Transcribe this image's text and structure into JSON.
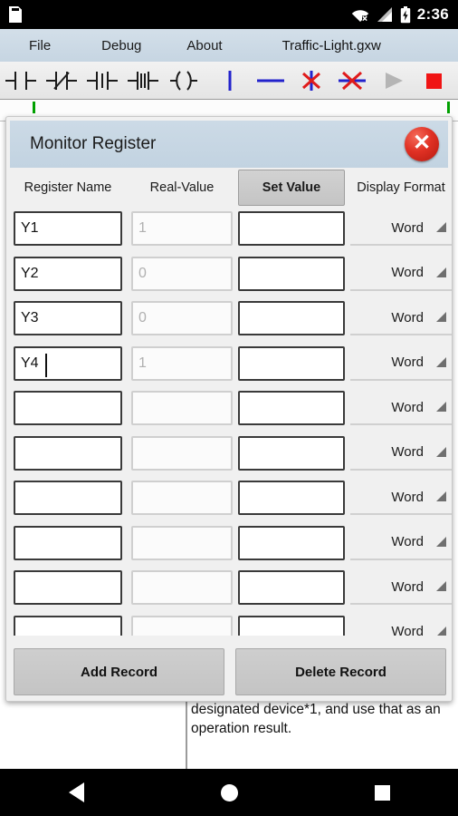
{
  "status_bar": {
    "storage_icon": "sdcard-icon",
    "wifi_icon": "wifi-off-icon",
    "signal_icon": "signal-bars-icon",
    "battery_icon": "battery-charging-icon",
    "time": "2:36"
  },
  "menubar": {
    "items": [
      {
        "label": "File",
        "name": "menu-file"
      },
      {
        "label": "Debug",
        "name": "menu-debug"
      },
      {
        "label": "About",
        "name": "menu-about"
      }
    ],
    "filename": "Traffic-Light.gxw"
  },
  "toolbar": {
    "icons": [
      "contact-no-icon",
      "contact-nc-icon",
      "contact-rising-icon",
      "contact-falling-icon",
      "coil-icon",
      "vertical-line-icon",
      "horizontal-line-icon",
      "delete-vertical-icon",
      "delete-horizontal-icon",
      "run-icon",
      "stop-icon"
    ],
    "accent_blue": "#2222cc",
    "accent_red": "#e01b1b",
    "run_disabled": "#b5b5b5"
  },
  "dialog": {
    "title": "Monitor Register",
    "close_label": "✕",
    "columns": [
      {
        "label": "Register Name",
        "name": "column-register-name"
      },
      {
        "label": "Real-Value",
        "name": "column-real-value"
      },
      {
        "label": "Set Value",
        "name": "column-set-value"
      },
      {
        "label": "Display Format",
        "name": "column-display-format"
      }
    ],
    "rows": [
      {
        "register_name": "Y1",
        "real_value": "1",
        "set_value": "",
        "display_format": "Word",
        "caret": false
      },
      {
        "register_name": "Y2",
        "real_value": "0",
        "set_value": "",
        "display_format": "Word",
        "caret": false
      },
      {
        "register_name": "Y3",
        "real_value": "0",
        "set_value": "",
        "display_format": "Word",
        "caret": false
      },
      {
        "register_name": "Y4",
        "real_value": "1",
        "set_value": "",
        "display_format": "Word",
        "caret": true
      },
      {
        "register_name": "",
        "real_value": "",
        "set_value": "",
        "display_format": "Word",
        "caret": false
      },
      {
        "register_name": "",
        "real_value": "",
        "set_value": "",
        "display_format": "Word",
        "caret": false
      },
      {
        "register_name": "",
        "real_value": "",
        "set_value": "",
        "display_format": "Word",
        "caret": false
      },
      {
        "register_name": "",
        "real_value": "",
        "set_value": "",
        "display_format": "Word",
        "caret": false
      },
      {
        "register_name": "",
        "real_value": "",
        "set_value": "",
        "display_format": "Word",
        "caret": false
      },
      {
        "register_name": "",
        "real_value": "",
        "set_value": "",
        "display_format": "Word",
        "caret": false
      }
    ],
    "actions": {
      "add_label": "Add Record",
      "delete_label": "Delete Record"
    }
  },
  "background_document": {
    "text": "designated device*1, and use that as an operation result."
  },
  "navbar": {
    "back": "back-icon",
    "home": "home-icon",
    "recents": "recents-icon"
  }
}
